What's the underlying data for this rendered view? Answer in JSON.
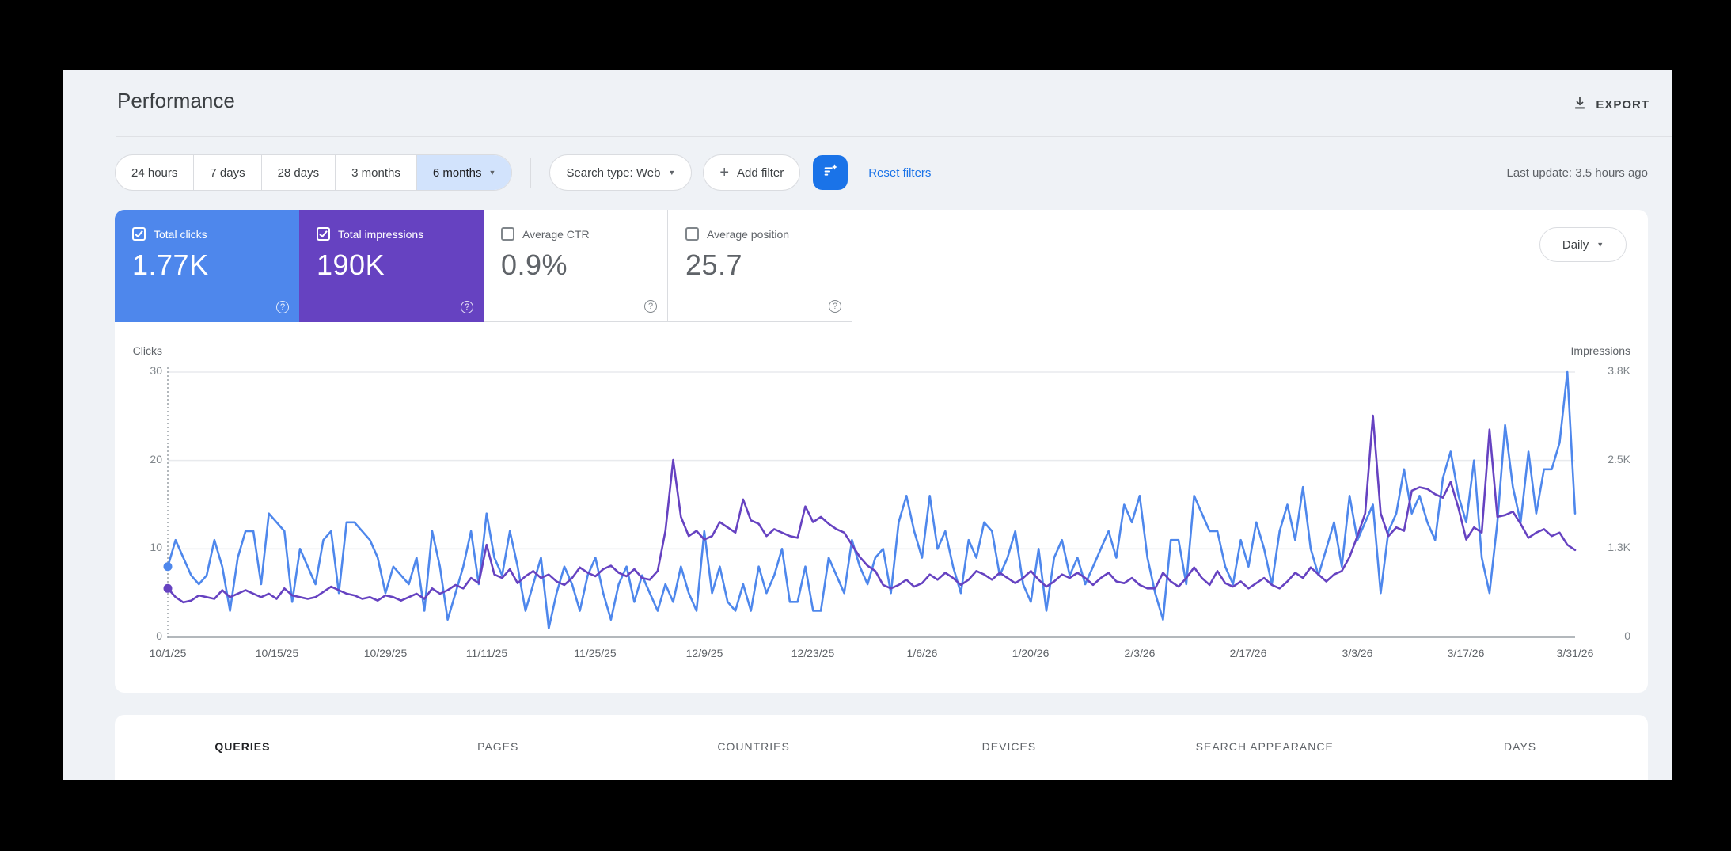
{
  "header": {
    "title": "Performance",
    "export_label": "EXPORT"
  },
  "filters": {
    "date_ranges": [
      "24 hours",
      "7 days",
      "28 days",
      "3 months",
      "6 months"
    ],
    "selected_range": "6 months",
    "search_type": "Search type: Web",
    "add_filter": "Add filter",
    "reset_filters": "Reset filters",
    "last_update": "Last update: 3.5 hours ago"
  },
  "metrics": [
    {
      "label": "Total clicks",
      "value": "1.77K",
      "checked": true,
      "color": "#4e87ec"
    },
    {
      "label": "Total impressions",
      "value": "190K",
      "checked": true,
      "color": "#6642c1"
    },
    {
      "label": "Average CTR",
      "value": "0.9%",
      "checked": false,
      "color": ""
    },
    {
      "label": "Average position",
      "value": "25.7",
      "checked": false,
      "color": ""
    }
  ],
  "granularity": "Daily",
  "tabs": [
    "QUERIES",
    "PAGES",
    "COUNTRIES",
    "DEVICES",
    "SEARCH APPEARANCE",
    "DAYS"
  ],
  "active_tab": "QUERIES",
  "colors": {
    "accent_link": "#1a73e8",
    "clicks": "#4e87ec",
    "impressions": "#6642c1",
    "selected_chip_bg": "#d2e3fc",
    "page_bg": "#eff2f6"
  },
  "chart_data": {
    "type": "line",
    "title": "Clicks and impressions over time (daily, 6 months)",
    "grid": "horizontal",
    "left_axis": {
      "label": "Clicks",
      "ticks_top_to_bottom": [
        "30",
        "20",
        "10",
        "0"
      ],
      "max": 30
    },
    "right_axis": {
      "label": "Impressions",
      "ticks_top_to_bottom": [
        "3.8K",
        "2.5K",
        "1.3K",
        "0"
      ],
      "max": 3800
    },
    "x_tick_labels": [
      "10/1/25",
      "10/15/25",
      "10/29/25",
      "11/11/25",
      "11/25/25",
      "12/9/25",
      "12/23/25",
      "1/6/26",
      "1/20/26",
      "2/3/26",
      "2/17/26",
      "3/3/26",
      "3/17/26",
      "3/31/26"
    ],
    "x_tick_days": [
      0,
      14,
      28,
      41,
      55,
      69,
      83,
      97,
      111,
      125,
      139,
      153,
      167,
      181
    ],
    "series": [
      {
        "name": "Clicks",
        "axis": "left",
        "color": "#4e87ec",
        "values": [
          8,
          11,
          9,
          7,
          6,
          7,
          11,
          8,
          3,
          9,
          12,
          12,
          6,
          14,
          13,
          12,
          4,
          10,
          8,
          6,
          11,
          12,
          5,
          13,
          13,
          12,
          11,
          9,
          5,
          8,
          7,
          6,
          9,
          3,
          12,
          8,
          2,
          5,
          8,
          12,
          6,
          14,
          9,
          7,
          12,
          8,
          3,
          6,
          9,
          1,
          5,
          8,
          6,
          3,
          7,
          9,
          5,
          2,
          6,
          8,
          4,
          7,
          5,
          3,
          6,
          4,
          8,
          5,
          3,
          12,
          5,
          8,
          4,
          3,
          6,
          3,
          8,
          5,
          7,
          10,
          4,
          4,
          8,
          3,
          3,
          9,
          7,
          5,
          11,
          8,
          6,
          9,
          10,
          5,
          13,
          16,
          12,
          9,
          16,
          10,
          12,
          8,
          5,
          11,
          9,
          13,
          12,
          7,
          9,
          12,
          6,
          4,
          10,
          3,
          9,
          11,
          7,
          9,
          6,
          8,
          10,
          12,
          9,
          15,
          13,
          16,
          9,
          5,
          2,
          11,
          11,
          6,
          16,
          14,
          12,
          12,
          8,
          6,
          11,
          8,
          13,
          10,
          6,
          12,
          15,
          11,
          17,
          10,
          7,
          10,
          13,
          8,
          16,
          11,
          13,
          15,
          5,
          12,
          14,
          19,
          14,
          16,
          13,
          11,
          18,
          21,
          16,
          13,
          20,
          9,
          5,
          13,
          24,
          17,
          13,
          21,
          14,
          19,
          19,
          22,
          30,
          14
        ]
      },
      {
        "name": "Impressions",
        "axis": "right",
        "color": "#6642c1",
        "values": [
          700,
          575,
          500,
          525,
          600,
          575,
          550,
          675,
          575,
          625,
          675,
          625,
          575,
          625,
          550,
          700,
          600,
          575,
          550,
          575,
          650,
          725,
          675,
          625,
          600,
          550,
          575,
          525,
          600,
          575,
          525,
          575,
          625,
          550,
          700,
          625,
          675,
          750,
          700,
          850,
          775,
          1325,
          900,
          850,
          975,
          775,
          875,
          950,
          850,
          900,
          800,
          750,
          850,
          1000,
          925,
          875,
          975,
          1025,
          925,
          875,
          975,
          850,
          825,
          950,
          1525,
          2540,
          1725,
          1450,
          1525,
          1400,
          1450,
          1650,
          1575,
          1500,
          1975,
          1675,
          1625,
          1450,
          1550,
          1500,
          1450,
          1425,
          1875,
          1650,
          1725,
          1625,
          1550,
          1500,
          1325,
          1150,
          1025,
          950,
          750,
          700,
          750,
          825,
          725,
          775,
          900,
          825,
          925,
          850,
          750,
          825,
          950,
          900,
          825,
          925,
          850,
          775,
          850,
          950,
          825,
          725,
          800,
          900,
          850,
          925,
          850,
          750,
          850,
          925,
          800,
          775,
          850,
          750,
          700,
          700,
          925,
          800,
          725,
          850,
          1000,
          850,
          750,
          950,
          775,
          725,
          800,
          700,
          775,
          850,
          750,
          700,
          800,
          925,
          850,
          1000,
          900,
          800,
          900,
          950,
          1150,
          1450,
          1775,
          3175,
          1775,
          1450,
          1575,
          1525,
          2100,
          2150,
          2125,
          2050,
          2000,
          2225,
          1850,
          1400,
          1575,
          1500,
          2975,
          1725,
          1750,
          1800,
          1625,
          1425,
          1500,
          1550,
          1450,
          1500,
          1325,
          1250
        ]
      }
    ]
  }
}
